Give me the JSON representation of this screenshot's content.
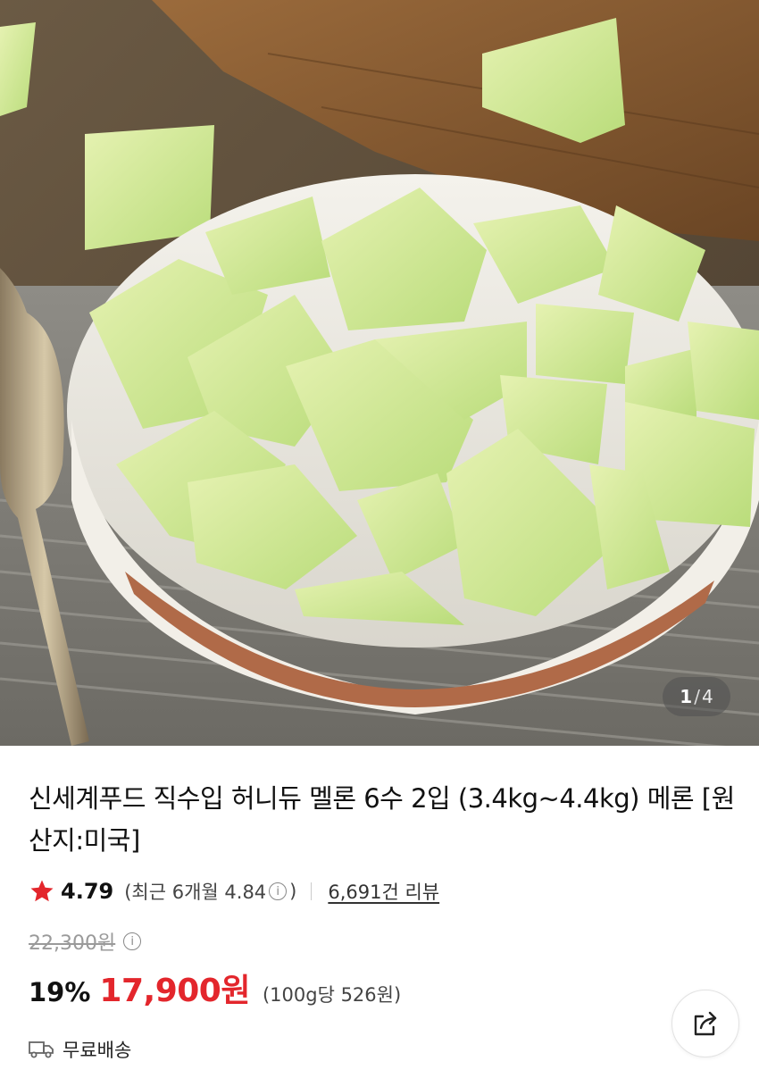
{
  "gallery": {
    "current_page": "1",
    "separator": "/",
    "total_pages": "4"
  },
  "product": {
    "title": "신세계푸드 직수입 허니듀 멜론 6수 2입 (3.4kg~4.4kg) 메론 [원산지:미국]",
    "rating": "4.79",
    "recent_rating_prefix": "(최근 6개월 4.84",
    "recent_rating_suffix": ")",
    "review_count": "6,691건 리뷰",
    "original_price": "22,300원",
    "discount_rate": "19%",
    "sale_price": "17,900원",
    "unit_price": "(100g당 526원)",
    "shipping": "무료배송"
  },
  "colors": {
    "accent_red": "#e3262c",
    "star": "#e3262c"
  },
  "icons": {
    "star": "star-icon",
    "info": "info-icon",
    "truck": "truck-icon",
    "share": "share-icon"
  }
}
